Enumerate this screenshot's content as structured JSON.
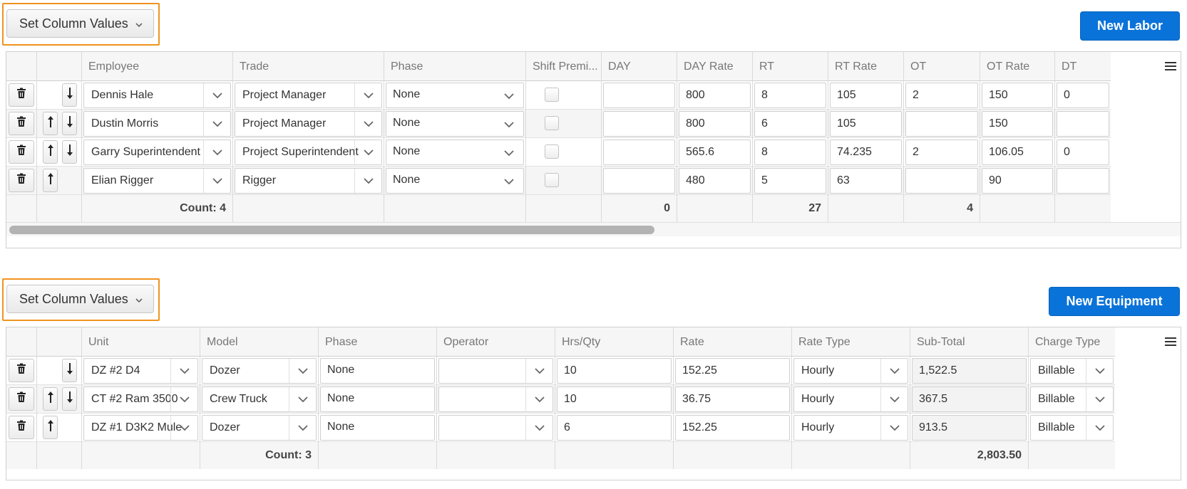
{
  "labor": {
    "set_column_values_label": "Set Column Values",
    "new_button_label": "New Labor",
    "columns": [
      "",
      "",
      "Employee",
      "Trade",
      "Phase",
      "Shift Premi...",
      "DAY",
      "DAY Rate",
      "RT",
      "RT Rate",
      "OT",
      "OT Rate",
      "DT"
    ],
    "rows": [
      {
        "up": false,
        "down": true,
        "employee": "Dennis Hale",
        "trade": "Project Manager",
        "phase": "None",
        "shift_premium": false,
        "day": "",
        "day_rate": "800",
        "rt": "8",
        "rt_rate": "105",
        "ot": "2",
        "ot_rate": "150",
        "dt": "0"
      },
      {
        "up": true,
        "down": true,
        "employee": "Dustin Morris",
        "trade": "Project Manager",
        "phase": "None",
        "shift_premium": false,
        "day": "",
        "day_rate": "800",
        "rt": "6",
        "rt_rate": "105",
        "ot": "",
        "ot_rate": "150",
        "dt": ""
      },
      {
        "up": true,
        "down": true,
        "employee": "Garry Superintendent",
        "trade": "Project Superintendent",
        "phase": "None",
        "shift_premium": false,
        "day": "",
        "day_rate": "565.6",
        "rt": "8",
        "rt_rate": "74.235",
        "ot": "2",
        "ot_rate": "106.05",
        "dt": "0"
      },
      {
        "up": true,
        "down": false,
        "employee": "Elian Rigger",
        "trade": "Rigger",
        "phase": "None",
        "shift_premium": false,
        "day": "",
        "day_rate": "480",
        "rt": "5",
        "rt_rate": "63",
        "ot": "",
        "ot_rate": "90",
        "dt": ""
      }
    ],
    "footer": {
      "count": "Count: 4",
      "day_total": "0",
      "rt_total": "27",
      "ot_total": "4"
    },
    "scroll_fraction": 0.58
  },
  "equipment": {
    "set_column_values_label": "Set Column Values",
    "new_button_label": "New Equipment",
    "columns": [
      "",
      "",
      "Unit",
      "Model",
      "Phase",
      "Operator",
      "Hrs/Qty",
      "Rate",
      "Rate Type",
      "Sub-Total",
      "Charge Type"
    ],
    "rows": [
      {
        "up": false,
        "down": true,
        "unit": "DZ #2 D4",
        "model": "Dozer",
        "phase": "None",
        "operator": "",
        "hrs_qty": "10",
        "rate": "152.25",
        "rate_type": "Hourly",
        "sub_total": "1,522.5",
        "charge_type": "Billable"
      },
      {
        "up": true,
        "down": true,
        "unit": "CT #2 Ram 3500",
        "model": "Crew Truck",
        "phase": "None",
        "operator": "",
        "hrs_qty": "10",
        "rate": "36.75",
        "rate_type": "Hourly",
        "sub_total": "367.5",
        "charge_type": "Billable"
      },
      {
        "up": true,
        "down": false,
        "unit": "DZ #1 D3K2 Mule",
        "model": "Dozer",
        "phase": "None",
        "operator": "",
        "hrs_qty": "6",
        "rate": "152.25",
        "rate_type": "Hourly",
        "sub_total": "913.5",
        "charge_type": "Billable"
      }
    ],
    "footer": {
      "count": "Count: 3",
      "sub_total_sum": "2,803.50"
    }
  },
  "icons": {
    "delete": "trash-icon",
    "move_up": "arrow-up-icon",
    "move_down": "arrow-down-icon",
    "dropdown": "chevron-down-icon",
    "column_menu": "hamburger-menu-icon"
  },
  "colors": {
    "accent": "#0a73d9",
    "highlight_outline": "#f0931f"
  }
}
